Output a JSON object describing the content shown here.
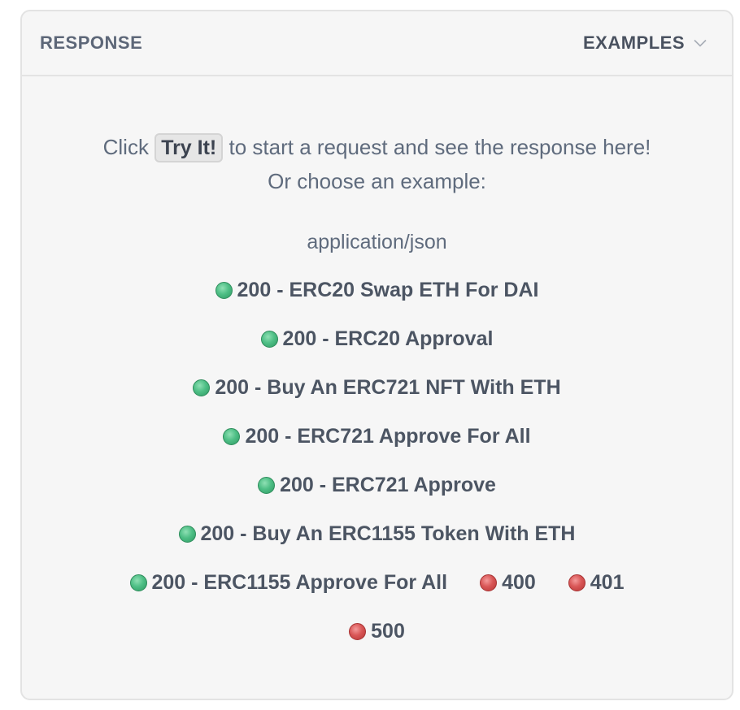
{
  "header": {
    "title": "RESPONSE",
    "examples_label": "EXAMPLES"
  },
  "intro": {
    "prefix": "Click",
    "button_label": "Try It!",
    "suffix": "to start a request and see the response here!",
    "line2": "Or choose an example:"
  },
  "mime_type": "application/json",
  "examples": [
    {
      "label": "200 - ERC20 Swap ETH For DAI",
      "status": "success"
    },
    {
      "label": "200 - ERC20 Approval",
      "status": "success"
    },
    {
      "label": "200 - Buy An ERC721 NFT With ETH",
      "status": "success"
    },
    {
      "label": "200 - ERC721 Approve For All",
      "status": "success"
    },
    {
      "label": "200 - ERC721 Approve",
      "status": "success"
    },
    {
      "label": "200 - Buy An ERC1155 Token With ETH",
      "status": "success"
    },
    {
      "label": "200 - ERC1155 Approve For All",
      "status": "success"
    },
    {
      "label": "400",
      "status": "error"
    },
    {
      "label": "401",
      "status": "error"
    },
    {
      "label": "500",
      "status": "error"
    }
  ],
  "colors": {
    "success": "#4fbf86",
    "error": "#d95757",
    "panel_bg": "#f6f6f6",
    "border": "#e3e3e3"
  },
  "icons": {
    "examples_toggle": "chevron-down-icon",
    "status_success": "green-dot-icon",
    "status_error": "red-dot-icon"
  }
}
